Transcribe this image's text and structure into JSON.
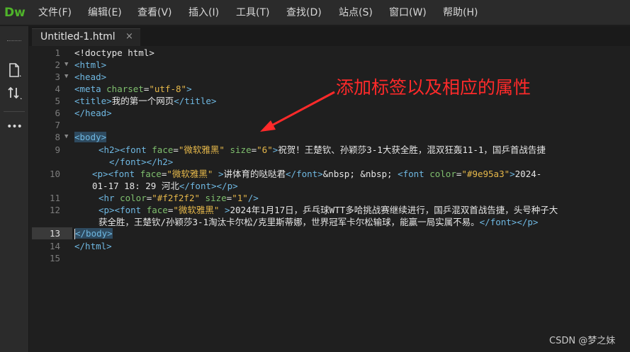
{
  "app": {
    "logo": "Dw"
  },
  "menu": [
    "文件(F)",
    "编辑(E)",
    "查看(V)",
    "插入(I)",
    "工具(T)",
    "查找(D)",
    "站点(S)",
    "窗口(W)",
    "帮助(H)"
  ],
  "tab": {
    "title": "Untitled-1.html",
    "close": "×"
  },
  "toolbar": {
    "icons": [
      "file-icon",
      "sort-icon",
      "more-icon"
    ],
    "more_label": "•••"
  },
  "editor": {
    "line_numbers": [
      "1",
      "2",
      "3",
      "4",
      "5",
      "6",
      "7",
      "8",
      "9",
      "",
      "10",
      "",
      "11",
      "12",
      "",
      "13",
      "14",
      "15"
    ],
    "active_line": "13",
    "lines": {
      "l1": "<!doctype html>",
      "l2": "<html>",
      "l3": "<head>",
      "l4a": "<meta ",
      "l4b": "charset",
      "l4c": "=",
      "l4d": "\"utf-8\"",
      "l4e": ">",
      "l5a": "<title>",
      "l5b": "我的第一个网页",
      "l5c": "</title>",
      "l6": "</head>",
      "l8": "<body>",
      "l9a": "<h2>",
      "l9b": "<font ",
      "l9c": "face",
      "l9d": "=",
      "l9e": "\"微软雅黑\"",
      "l9f": " size",
      "l9g": "=",
      "l9h": "\"6\"",
      "l9i": ">",
      "l9j": "祝贺！王楚钦、孙颖莎3-1大获全胜，混双狂轰11-1，国乒首战告捷",
      "l9k": "</font></h2>",
      "l10a": "<p>",
      "l10b": "<font ",
      "l10c": "face",
      "l10d": "=",
      "l10e": "\"微软雅黑\"",
      "l10f": " >",
      "l10g": "讲体育的哒哒君",
      "l10h": "</font>",
      "l10i": "&nbsp; &nbsp;  ",
      "l10j": "<font ",
      "l10k": "color",
      "l10l": "=",
      "l10m": "\"#9e95a3\"",
      "l10n": ">",
      "l10o": "2024-",
      "l10p": "01-17 18: 29 河北",
      "l10q": "</font></p>",
      "l11a": "<hr ",
      "l11b": "color",
      "l11c": "=",
      "l11d": "\"#f2f2f2\"",
      "l11e": " size",
      "l11f": "=",
      "l11g": "\"1\"",
      "l11h": "/>",
      "l12a": "<p>",
      "l12b": "<font ",
      "l12c": "face",
      "l12d": "=",
      "l12e": "\"微软雅黑\"",
      "l12f": " >",
      "l12g": "2024年1月17日，乒乓球WTT多哈挑战赛继续进行，国乒混双首战告捷，头号种子大",
      "l12h": "获全胜，王楚钦/孙颖莎3-1淘汰卡尔松/克里斯蒂娜，世界冠军卡尔松输球，能赢一局实属不易。",
      "l12i": "</font></p>",
      "l13": "</body>",
      "l14": "</html>"
    }
  },
  "annotation": {
    "text": "添加标签以及相应的属性",
    "color": "#ff2a2a"
  },
  "watermark": "CSDN @梦之妹"
}
